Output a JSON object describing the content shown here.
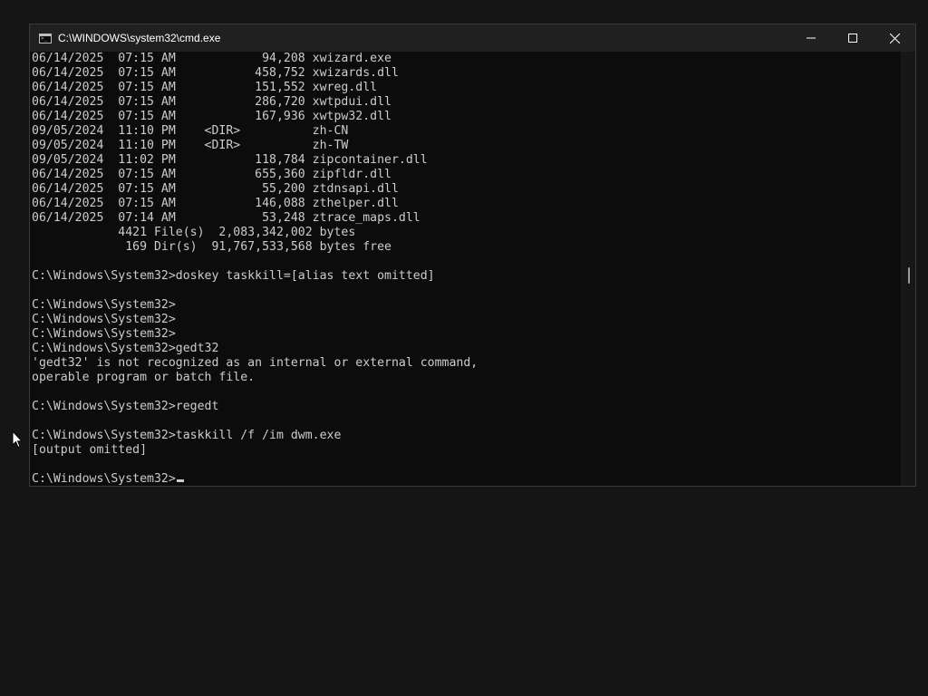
{
  "window": {
    "title": "C:\\WINDOWS\\system32\\cmd.exe",
    "controls": {
      "minimize": "minimize-icon",
      "maximize": "maximize-icon",
      "close": "close-icon"
    }
  },
  "console": {
    "lines": [
      "06/14/2025  07:15 AM            94,208 xwizard.exe",
      "06/14/2025  07:15 AM           458,752 xwizards.dll",
      "06/14/2025  07:15 AM           151,552 xwreg.dll",
      "06/14/2025  07:15 AM           286,720 xwtpdui.dll",
      "06/14/2025  07:15 AM           167,936 xwtpw32.dll",
      "09/05/2024  11:10 PM    <DIR>          zh-CN",
      "09/05/2024  11:10 PM    <DIR>          zh-TW",
      "09/05/2024  11:02 PM           118,784 zipcontainer.dll",
      "06/14/2025  07:15 AM           655,360 zipfldr.dll",
      "06/14/2025  07:15 AM            55,200 ztdnsapi.dll",
      "06/14/2025  07:15 AM           146,088 zthelper.dll",
      "06/14/2025  07:14 AM            53,248 ztrace_maps.dll",
      "            4421 File(s)  2,083,342,002 bytes",
      "             169 Dir(s)  91,767,533,568 bytes free",
      "",
      "C:\\Windows\\System32>doskey taskkill=[alias text omitted]",
      "",
      "C:\\Windows\\System32>",
      "C:\\Windows\\System32>",
      "C:\\Windows\\System32>",
      "C:\\Windows\\System32>gedt32",
      "'gedt32' is not recognized as an internal or external command,",
      "operable program or batch file.",
      "",
      "C:\\Windows\\System32>regedt",
      "",
      "C:\\Windows\\System32>taskkill /f /im dwm.exe",
      "[output omitted]",
      "",
      "C:\\Windows\\System32>"
    ]
  },
  "colors": {
    "console_bg": "#0c0c0c",
    "console_fg": "#cccccc",
    "titlebar_bg": "#202020"
  }
}
